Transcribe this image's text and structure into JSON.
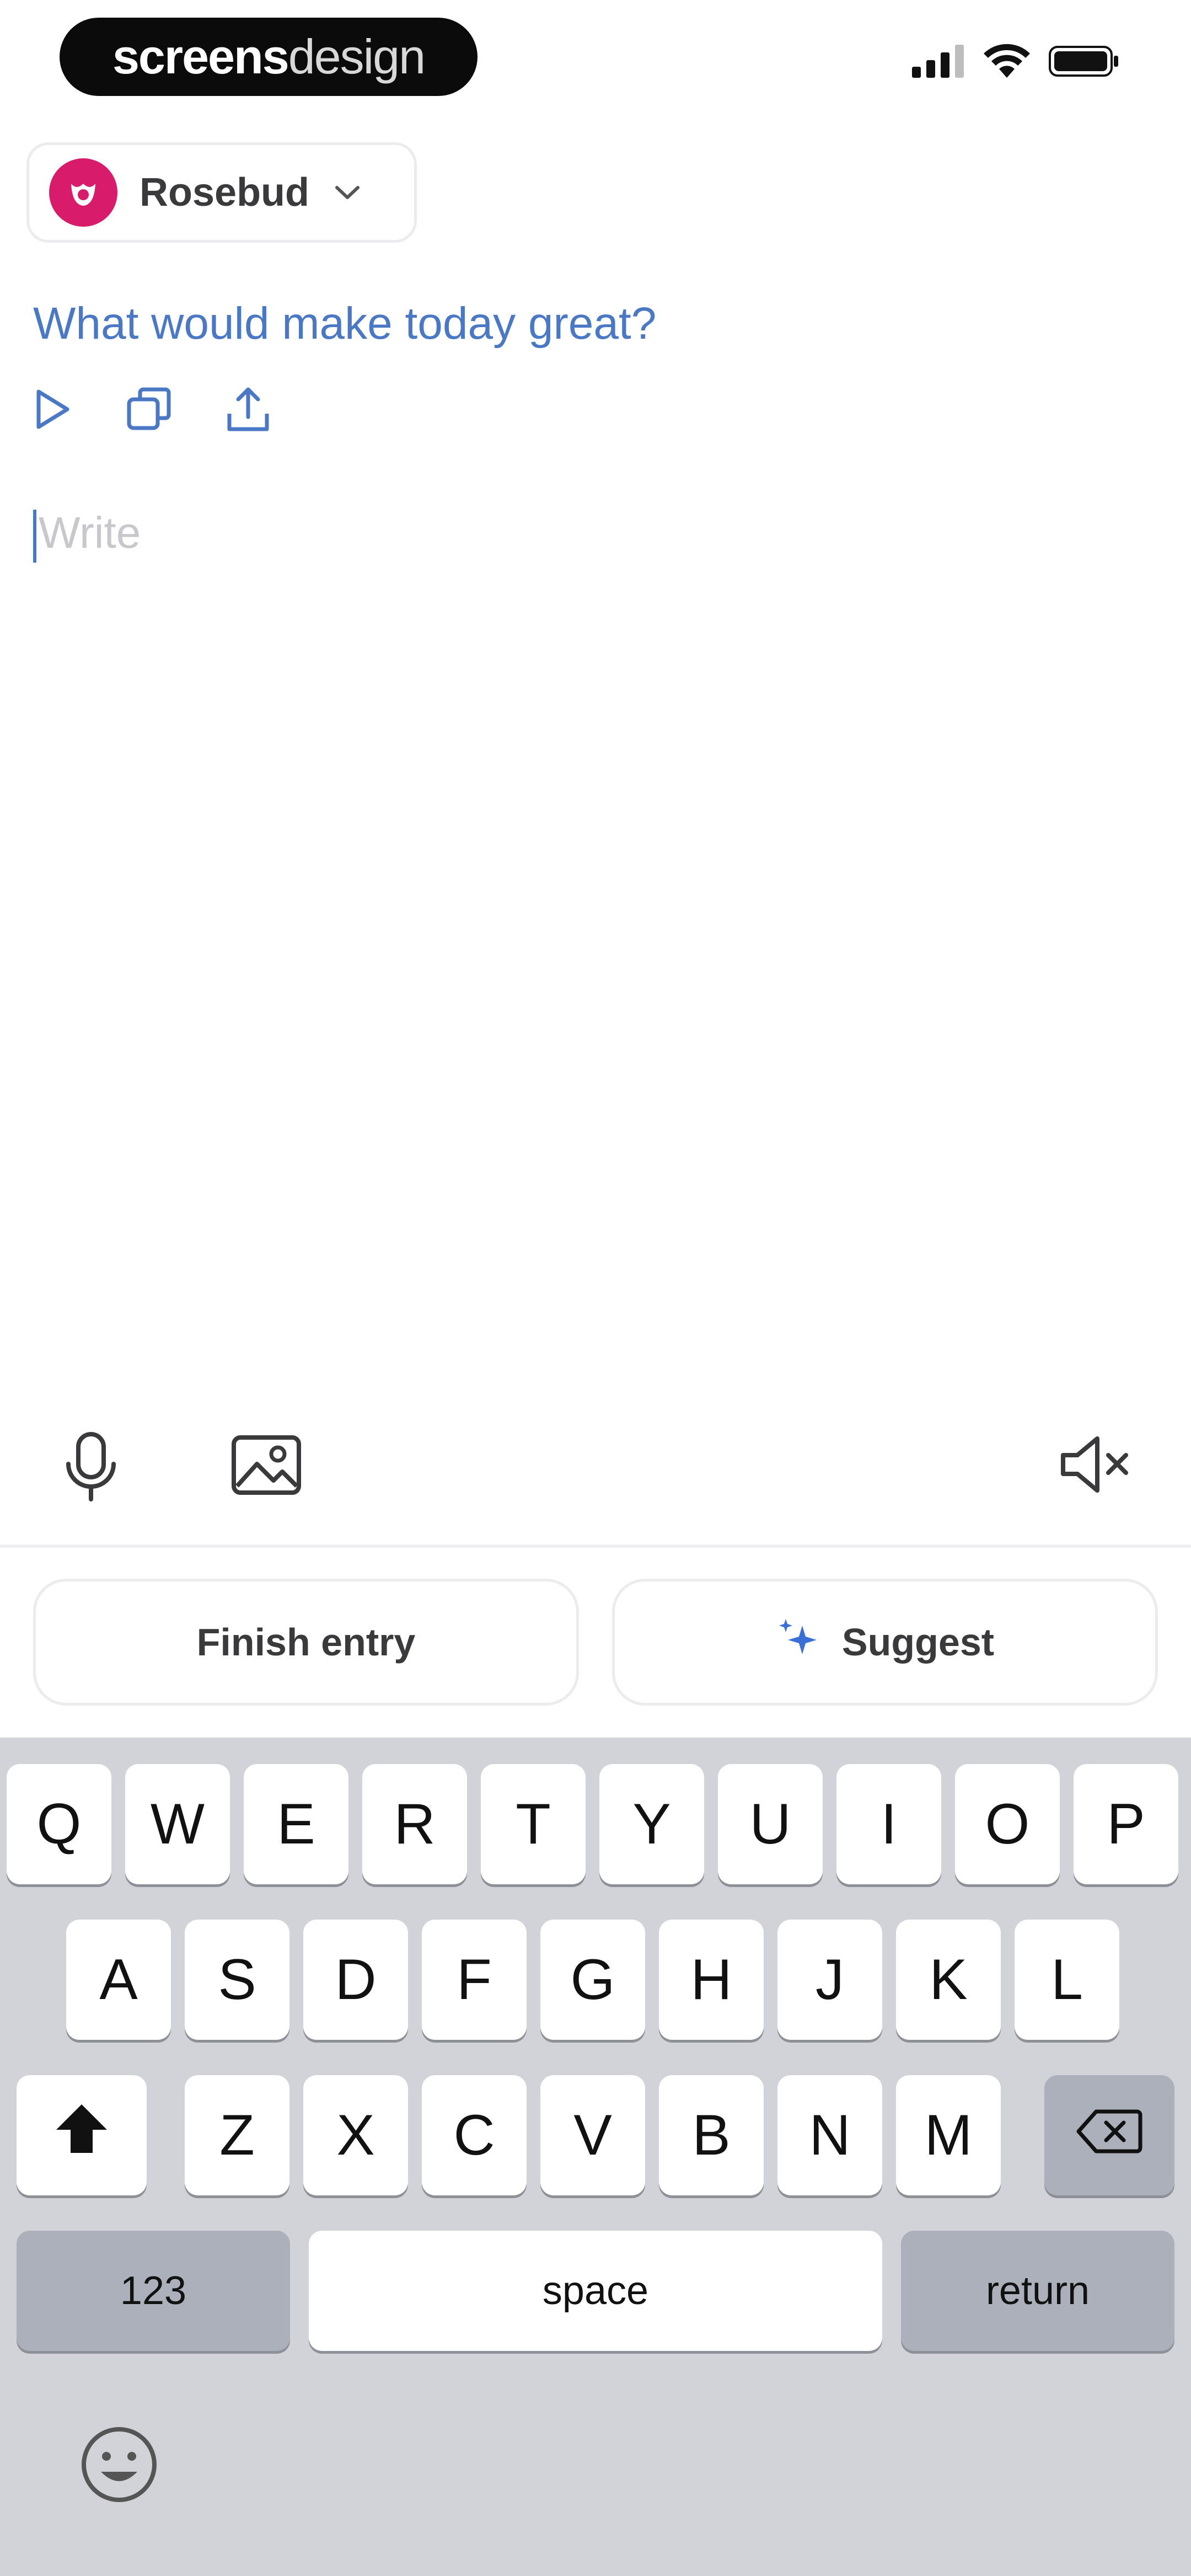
{
  "status_bar": {
    "brand_bold": "screens",
    "brand_light": "design",
    "icons": [
      "signal-icon",
      "wifi-icon",
      "battery-icon"
    ]
  },
  "journal": {
    "name": "Rosebud",
    "avatar_color": "#d81b6a",
    "icon": "rose-icon"
  },
  "prompt": {
    "text": "What would make today great?",
    "color": "#4a78c4",
    "actions": [
      "play-icon",
      "copy-icon",
      "share-icon"
    ]
  },
  "editor": {
    "placeholder": "Write"
  },
  "media_toolbar": {
    "icons": [
      "microphone-icon",
      "image-icon",
      "speaker-muted-icon"
    ]
  },
  "entry_actions": {
    "finish_label": "Finish entry",
    "suggest_label": "Suggest",
    "suggest_icon": "sparkle-icon"
  },
  "keyboard": {
    "row1": [
      "Q",
      "W",
      "E",
      "R",
      "T",
      "Y",
      "U",
      "I",
      "O",
      "P"
    ],
    "row2": [
      "A",
      "S",
      "D",
      "F",
      "G",
      "H",
      "J",
      "K",
      "L"
    ],
    "row3": [
      "Z",
      "X",
      "C",
      "V",
      "B",
      "N",
      "M"
    ],
    "numbers_label": "123",
    "space_label": "space",
    "return_label": "return",
    "special_icons": [
      "shift-icon",
      "backspace-icon",
      "emoji-icon"
    ]
  }
}
